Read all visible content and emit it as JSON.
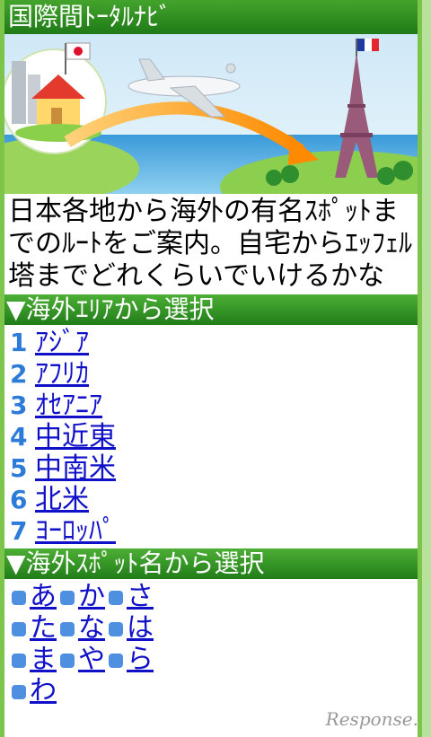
{
  "header": {
    "title": "国際間ﾄｰﾀﾙﾅﾋﾞ"
  },
  "hero": {
    "icons": [
      "house-icon",
      "japan-flag-icon",
      "airplane-icon",
      "eiffel-tower-icon",
      "france-flag-icon"
    ]
  },
  "description": "日本各地から海外の有名ｽﾎﾟｯﾄまでのﾙｰﾄをご案内。自宅からｴｯﾌｪﾙ塔までどれくらいでいけるかな",
  "regions": {
    "title": "▼海外ｴﾘｱから選択",
    "items": [
      {
        "num": "1",
        "label": "ｱｼﾞｱ"
      },
      {
        "num": "2",
        "label": "ｱﾌﾘｶ"
      },
      {
        "num": "3",
        "label": "ｵｾｱﾆｱ"
      },
      {
        "num": "4",
        "label": "中近東"
      },
      {
        "num": "5",
        "label": "中南米"
      },
      {
        "num": "6",
        "label": "北米"
      },
      {
        "num": "7",
        "label": "ﾖｰﾛｯﾊﾟ"
      }
    ]
  },
  "spots": {
    "title": "▼海外ｽﾎﾟｯﾄ名から選択",
    "rows": [
      [
        "あ",
        "か",
        "さ"
      ],
      [
        "た",
        "な",
        "は"
      ],
      [
        "ま",
        "や",
        "ら"
      ],
      [
        "わ"
      ]
    ]
  },
  "watermark": "Response."
}
